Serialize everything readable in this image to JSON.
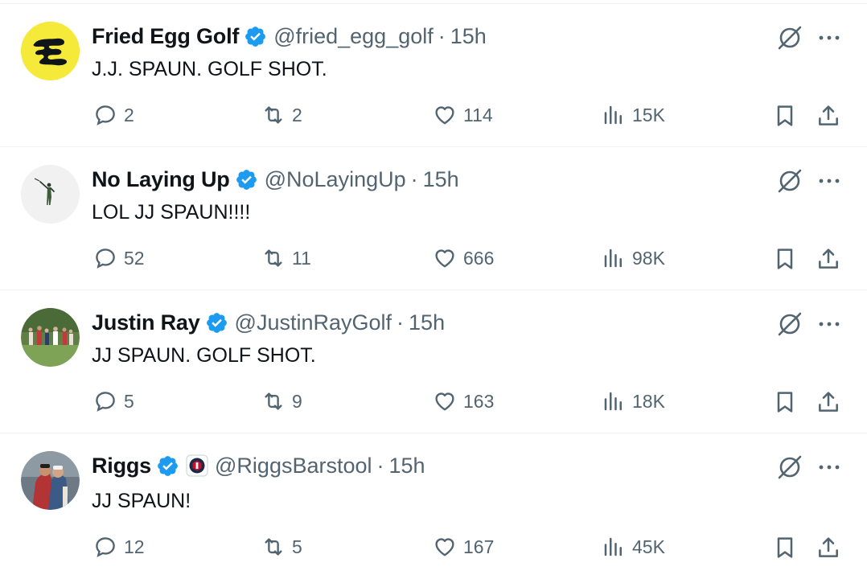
{
  "tweets": [
    {
      "name": "Fried Egg Golf",
      "handle": "@fried_egg_golf",
      "separator": "·",
      "time": "15h",
      "text": "J.J. SPAUN. GOLF SHOT.",
      "replies": "2",
      "retweets": "2",
      "likes": "114",
      "views": "15K",
      "avatar_desc": "fried-egg-golf-logo"
    },
    {
      "name": "No Laying Up",
      "handle": "@NoLayingUp",
      "separator": "·",
      "time": "15h",
      "text": "LOL JJ SPAUN!!!!",
      "replies": "52",
      "retweets": "11",
      "likes": "666",
      "views": "98K",
      "avatar_desc": "no-laying-up-golfer-logo"
    },
    {
      "name": "Justin Ray",
      "handle": "@JustinRayGolf",
      "separator": "·",
      "time": "15h",
      "text": "JJ SPAUN. GOLF SHOT.",
      "replies": "5",
      "retweets": "9",
      "likes": "163",
      "views": "18K",
      "avatar_desc": "golf-crowd-photo"
    },
    {
      "name": "Riggs",
      "handle": "@RiggsBarstool",
      "separator": "·",
      "time": "15h",
      "text": "JJ SPAUN!",
      "replies": "12",
      "retweets": "5",
      "likes": "167",
      "views": "45K",
      "avatar_desc": "golfer-hug-photo",
      "affiliate_badge": "barstool-badge"
    }
  ],
  "colors": {
    "text": "#0f1419",
    "secondary": "#536471",
    "verified_blue": "#1d9bf0",
    "divider": "#eff3f4",
    "fried_egg_yellow": "#f5e93a"
  },
  "icons": {
    "reply": "reply-icon",
    "retweet": "retweet-icon",
    "like": "heart-icon",
    "views": "views-chart-icon",
    "bookmark": "bookmark-icon",
    "share": "share-icon",
    "grok": "grok-icon",
    "more": "more-icon",
    "verified": "verified-badge-icon"
  }
}
